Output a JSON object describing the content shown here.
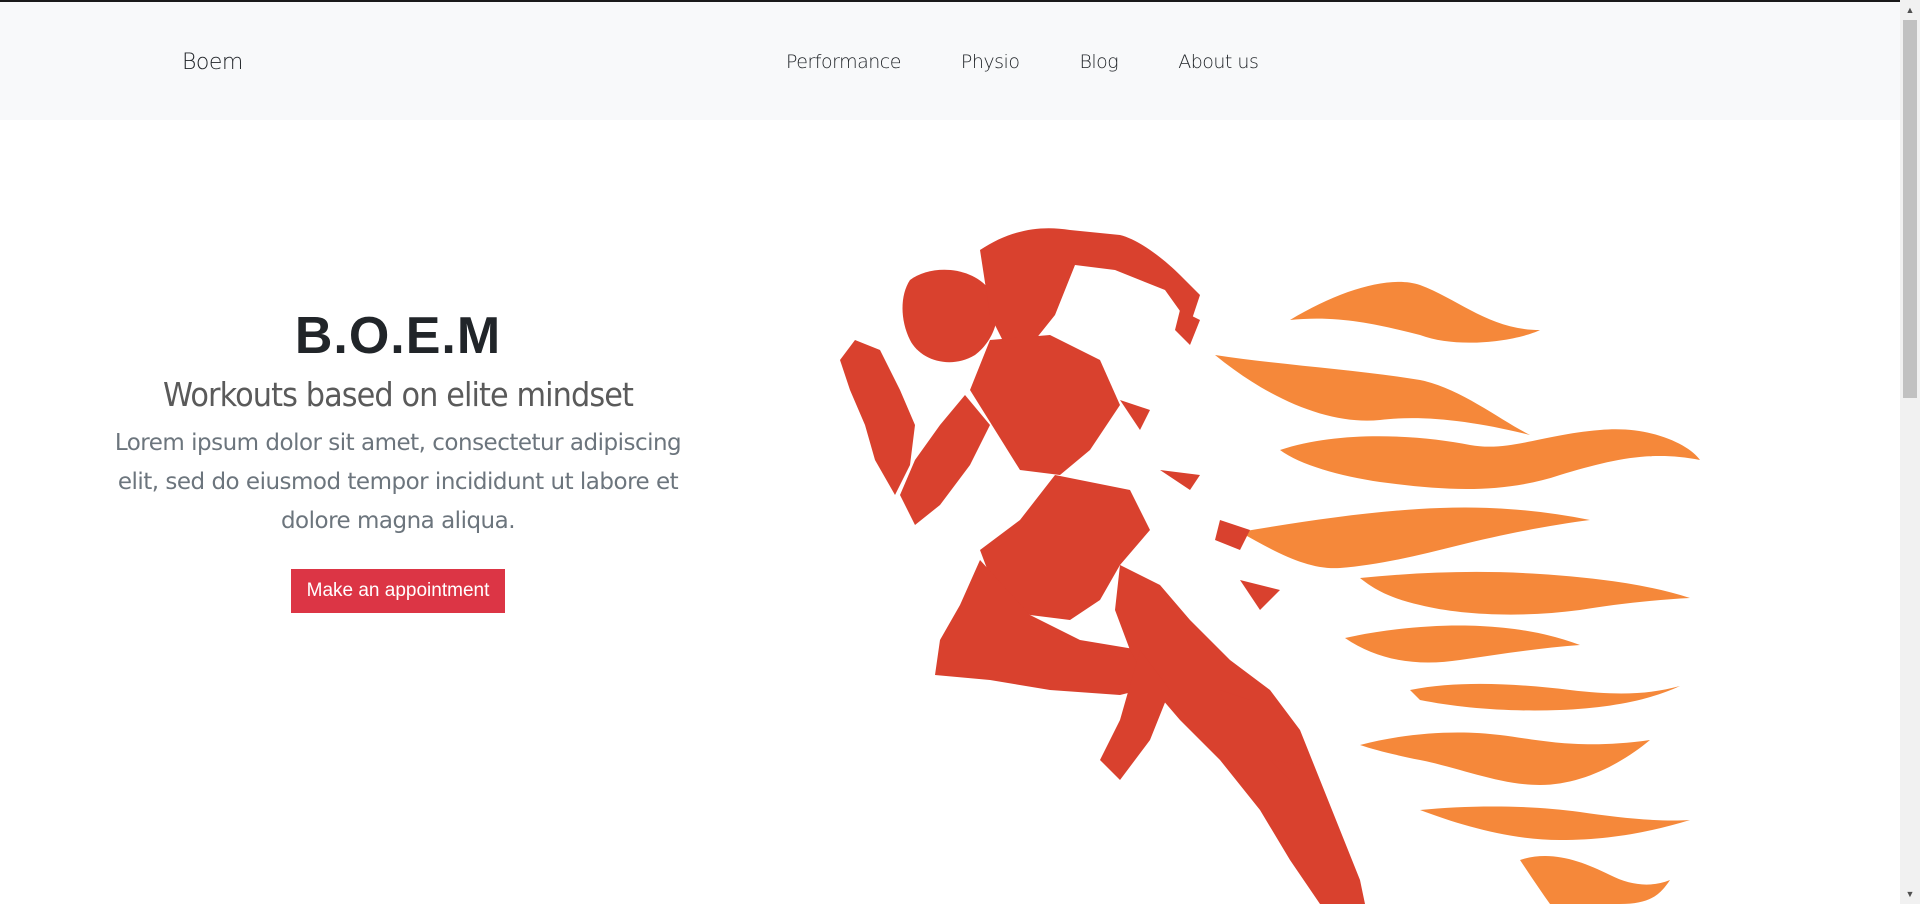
{
  "navbar": {
    "brand": "Boem",
    "links": [
      "Performance",
      "Physio",
      "Blog",
      "About us"
    ]
  },
  "hero": {
    "title": "B.O.E.M",
    "subtitle": "Workouts based on elite mindset",
    "lorem": "Lorem ipsum dolor sit amet, consectetur adipiscing elit, sed do eiusmod tempor incididunt ut labore et dolore magna aliqua.",
    "cta": "Make an appointment"
  },
  "colors": {
    "accent": "#dc3545",
    "runner": "#d9412e",
    "flames": "#f5883a"
  },
  "scrollbar": {
    "up_icon": "scroll-up-arrow-icon",
    "down_icon": "scroll-down-arrow-icon"
  }
}
